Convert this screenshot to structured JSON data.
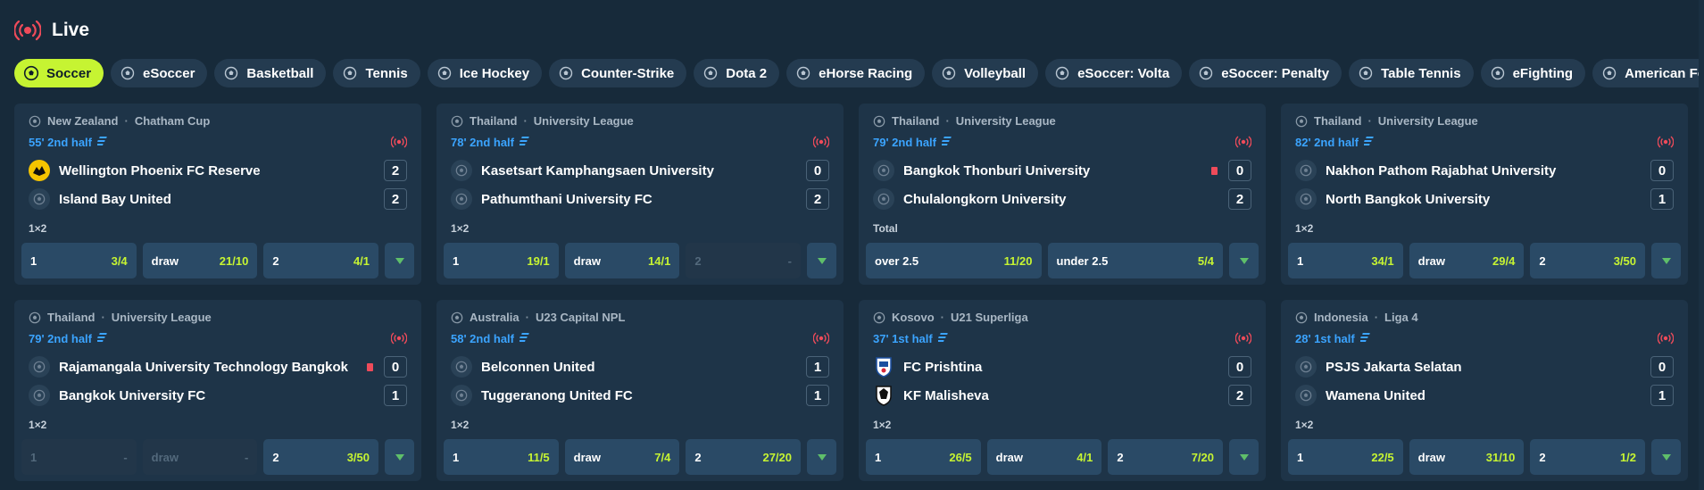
{
  "header": {
    "title": "Live"
  },
  "tabs": [
    {
      "label": "Soccer",
      "icon": "soccer-ball-icon",
      "active": true
    },
    {
      "label": "eSoccer",
      "icon": "esoccer-icon"
    },
    {
      "label": "Basketball",
      "icon": "basketball-icon"
    },
    {
      "label": "Tennis",
      "icon": "tennis-icon"
    },
    {
      "label": "Ice Hockey",
      "icon": "ice-hockey-icon"
    },
    {
      "label": "Counter-Strike",
      "icon": "counter-strike-icon"
    },
    {
      "label": "Dota 2",
      "icon": "dota-icon"
    },
    {
      "label": "eHorse Racing",
      "icon": "horse-racing-icon"
    },
    {
      "label": "Volleyball",
      "icon": "volleyball-icon"
    },
    {
      "label": "eSoccer: Volta",
      "icon": "esoccer-volta-icon"
    },
    {
      "label": "eSoccer: Penalty",
      "icon": "esoccer-penalty-icon"
    },
    {
      "label": "Table Tennis",
      "icon": "table-tennis-icon"
    },
    {
      "label": "eFighting",
      "icon": "efighting-icon"
    },
    {
      "label": "American Football",
      "icon": "american-football-icon"
    }
  ],
  "colors": {
    "accent": "#c6f432",
    "time": "#3ba4ff",
    "live": "#ef4b5a",
    "background": "#172a3a",
    "card": "#1e3448",
    "odd_button": "#2a4a66"
  },
  "matches": [
    {
      "country": "New Zealand",
      "league": "Chatham Cup",
      "time": "55' 2nd half",
      "team1": {
        "name": "Wellington Phoenix FC Reserve",
        "score": "2",
        "logo": "phoenix-logo-icon"
      },
      "team2": {
        "name": "Island Bay United",
        "score": "2",
        "logo": "generic-team-icon"
      },
      "market": "1×2",
      "odds": [
        {
          "name": "1",
          "value": "3/4"
        },
        {
          "name": "draw",
          "value": "21/10"
        },
        {
          "name": "2",
          "value": "4/1"
        }
      ]
    },
    {
      "country": "Thailand",
      "league": "University League",
      "time": "78' 2nd half",
      "team1": {
        "name": "Kasetsart Kamphangsaen University",
        "score": "0",
        "logo": "generic-team-icon"
      },
      "team2": {
        "name": "Pathumthani University FC",
        "score": "2",
        "logo": "generic-team-icon"
      },
      "market": "1×2",
      "odds": [
        {
          "name": "1",
          "value": "19/1"
        },
        {
          "name": "draw",
          "value": "14/1"
        },
        {
          "name": "2",
          "value": "-",
          "disabled": true
        }
      ]
    },
    {
      "country": "Thailand",
      "league": "University League",
      "time": "79' 2nd half",
      "team1": {
        "name": "Bangkok Thonburi University",
        "score": "0",
        "logo": "generic-team-icon",
        "red_card": true
      },
      "team2": {
        "name": "Chulalongkorn University",
        "score": "2",
        "logo": "generic-team-icon"
      },
      "market": "Total",
      "odds": [
        {
          "name": "over 2.5",
          "value": "11/20"
        },
        {
          "name": "under 2.5",
          "value": "5/4"
        }
      ]
    },
    {
      "country": "Thailand",
      "league": "University League",
      "time": "82' 2nd half",
      "team1": {
        "name": "Nakhon Pathom Rajabhat University",
        "score": "0",
        "logo": "generic-team-icon"
      },
      "team2": {
        "name": "North Bangkok University",
        "score": "1",
        "logo": "generic-team-icon"
      },
      "market": "1×2",
      "odds": [
        {
          "name": "1",
          "value": "34/1"
        },
        {
          "name": "draw",
          "value": "29/4"
        },
        {
          "name": "2",
          "value": "3/50"
        }
      ]
    },
    {
      "country": "Thailand",
      "league": "University League",
      "time": "79' 2nd half",
      "team1": {
        "name": "Rajamangala University Technology Bangkok",
        "score": "0",
        "logo": "generic-team-icon",
        "red_card": true
      },
      "team2": {
        "name": "Bangkok University FC",
        "score": "1",
        "logo": "generic-team-icon"
      },
      "market": "1×2",
      "odds": [
        {
          "name": "1",
          "value": "-",
          "disabled": true
        },
        {
          "name": "draw",
          "value": "-",
          "disabled": true
        },
        {
          "name": "2",
          "value": "3/50"
        }
      ]
    },
    {
      "country": "Australia",
      "league": "U23 Capital NPL",
      "time": "58' 2nd half",
      "team1": {
        "name": "Belconnen United",
        "score": "1",
        "logo": "generic-team-icon"
      },
      "team2": {
        "name": "Tuggeranong United FC",
        "score": "1",
        "logo": "generic-team-icon"
      },
      "market": "1×2",
      "odds": [
        {
          "name": "1",
          "value": "11/5"
        },
        {
          "name": "draw",
          "value": "7/4"
        },
        {
          "name": "2",
          "value": "27/20"
        }
      ]
    },
    {
      "country": "Kosovo",
      "league": "U21 Superliga",
      "time": "37' 1st half",
      "team1": {
        "name": "FC Prishtina",
        "score": "0",
        "logo": "prishtina-crest-icon"
      },
      "team2": {
        "name": "KF Malisheva",
        "score": "2",
        "logo": "malisheva-crest-icon"
      },
      "market": "1×2",
      "odds": [
        {
          "name": "1",
          "value": "26/5"
        },
        {
          "name": "draw",
          "value": "4/1"
        },
        {
          "name": "2",
          "value": "7/20"
        }
      ]
    },
    {
      "country": "Indonesia",
      "league": "Liga 4",
      "time": "28' 1st half",
      "team1": {
        "name": "PSJS Jakarta Selatan",
        "score": "0",
        "logo": "generic-team-icon"
      },
      "team2": {
        "name": "Wamena United",
        "score": "1",
        "logo": "generic-team-icon"
      },
      "market": "1×2",
      "odds": [
        {
          "name": "1",
          "value": "22/5"
        },
        {
          "name": "draw",
          "value": "31/10"
        },
        {
          "name": "2",
          "value": "1/2"
        }
      ]
    }
  ]
}
